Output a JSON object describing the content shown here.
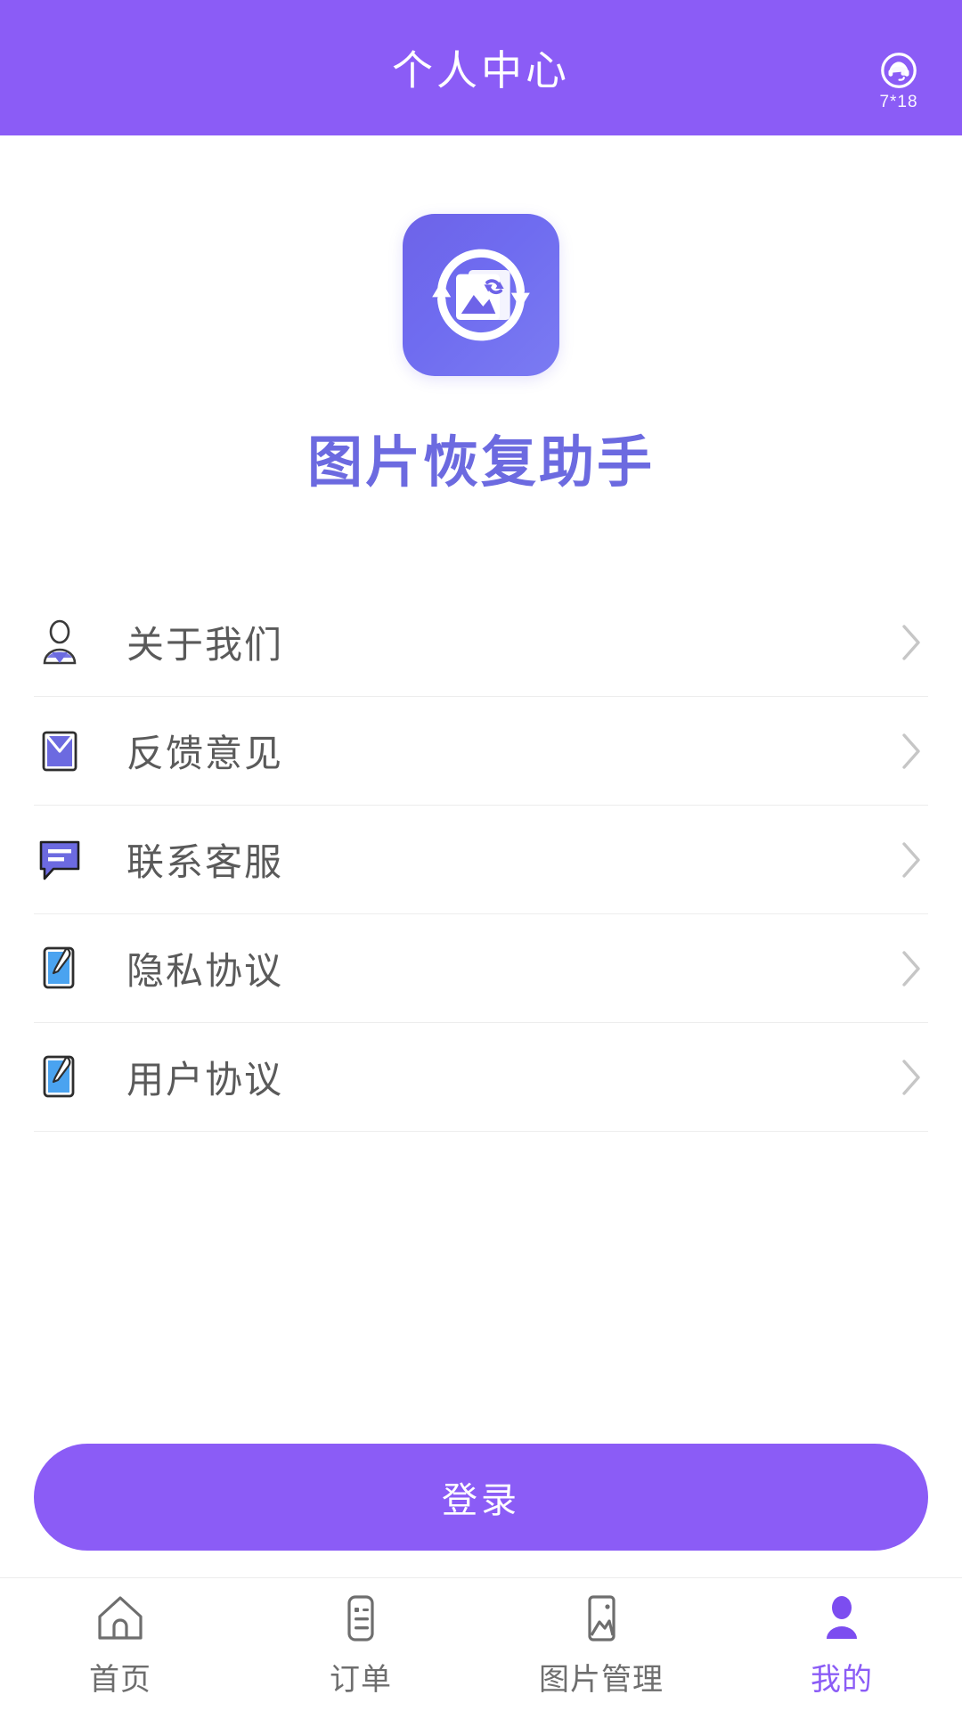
{
  "header": {
    "title": "个人中心",
    "service_icon": "headset-icon",
    "service_label": "7*18"
  },
  "brand": {
    "logo_icon": "image-restore-logo",
    "app_name": "图片恢复助手"
  },
  "menu": {
    "items": [
      {
        "label": "关于我们",
        "icon": "user-icon",
        "chevron": "chevron-right-icon"
      },
      {
        "label": "反馈意见",
        "icon": "envelope-icon",
        "chevron": "chevron-right-icon"
      },
      {
        "label": "联系客服",
        "icon": "chat-icon",
        "chevron": "chevron-right-icon"
      },
      {
        "label": "隐私协议",
        "icon": "edit-note-icon",
        "chevron": "chevron-right-icon"
      },
      {
        "label": "用户协议",
        "icon": "edit-note-icon",
        "chevron": "chevron-right-icon"
      }
    ]
  },
  "login": {
    "label": "登录"
  },
  "tabbar": {
    "items": [
      {
        "label": "首页",
        "icon": "home-icon",
        "active": false
      },
      {
        "label": "订单",
        "icon": "order-icon",
        "active": false
      },
      {
        "label": "图片管理",
        "icon": "picture-icon",
        "active": false
      },
      {
        "label": "我的",
        "icon": "person-icon",
        "active": true
      }
    ]
  },
  "colors": {
    "header_purple": "#8b5cf6",
    "brand_purple": "#6c6ae0",
    "logo_purple": "#6e63e8",
    "accent": "#8b5cf6",
    "icon_blue": "#4aa3f0",
    "text_gray": "#5a5a5a",
    "divider": "#ededed"
  }
}
